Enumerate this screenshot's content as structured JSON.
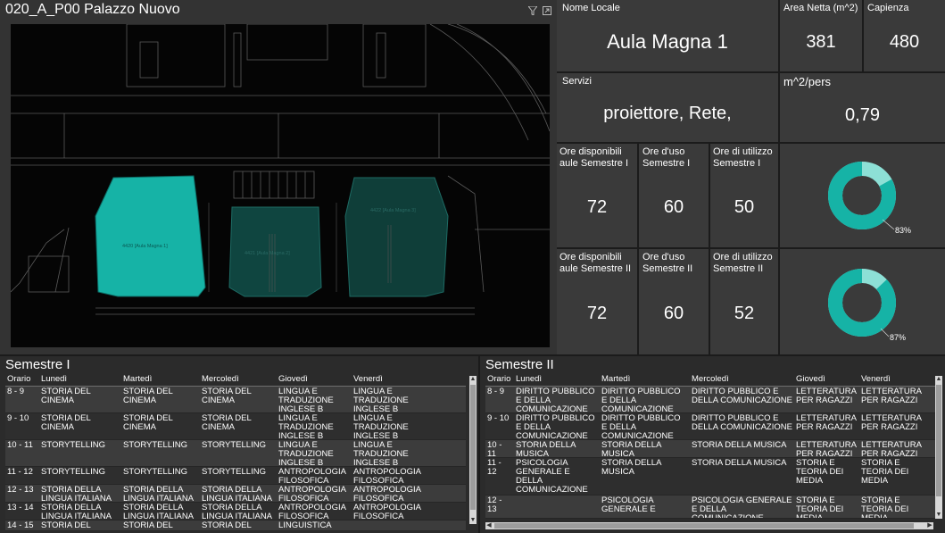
{
  "map": {
    "title": "020_A_P00 Palazzo Nuovo",
    "rooms": [
      "4420 [Aula Magna 1]",
      "4421 [Aula Magna 2]",
      "4422 [Aula Magna 3]"
    ]
  },
  "nome_locale": {
    "label": "Nome Locale",
    "value": "Aula Magna 1"
  },
  "area_netta": {
    "label": "Area Netta (m^2)",
    "value": "381"
  },
  "capienza": {
    "label": "Capienza",
    "value": "480"
  },
  "servizi": {
    "label": "Servizi",
    "value": "proiettore, Rete,"
  },
  "m2_pers": {
    "label": "m^2/pers",
    "value": "0,79"
  },
  "sem1_cards": [
    {
      "label": "Ore disponibili aule Semestre I",
      "value": "72"
    },
    {
      "label": "Ore d'uso Semestre I",
      "value": "60"
    },
    {
      "label": "Ore di utilizzo Semestre I",
      "value": "50"
    }
  ],
  "sem2_cards": [
    {
      "label": "Ore disponibili aule Semestre II",
      "value": "72"
    },
    {
      "label": "Ore d'uso Semestre II",
      "value": "60"
    },
    {
      "label": "Ore di utilizzo Semestre II",
      "value": "52"
    }
  ],
  "donut1": {
    "percent": 83,
    "label": "83%"
  },
  "donut2": {
    "percent": 87,
    "label": "87%"
  },
  "colors": {
    "teal": "#16b3a6",
    "teal_light": "#8de0d6",
    "panel": "#3a3a3a"
  },
  "semestre1": {
    "title": "Semestre I",
    "headers": [
      "Orario",
      "Lunedì",
      "Martedì",
      "Mercoledì",
      "Giovedì",
      "Venerdì"
    ],
    "rows": [
      [
        "8 - 9",
        "STORIA DEL CINEMA",
        "STORIA DEL CINEMA",
        "STORIA DEL CINEMA",
        "LINGUA E TRADUZIONE INGLESE B",
        "LINGUA E TRADUZIONE INGLESE B"
      ],
      [
        "9 - 10",
        "STORIA DEL CINEMA",
        "STORIA DEL CINEMA",
        "STORIA DEL CINEMA",
        "LINGUA E TRADUZIONE INGLESE B",
        "LINGUA E TRADUZIONE INGLESE B"
      ],
      [
        "10 - 11",
        "STORYTELLING",
        "STORYTELLING",
        "STORYTELLING",
        "LINGUA E TRADUZIONE INGLESE B",
        "LINGUA E TRADUZIONE INGLESE B"
      ],
      [
        "11 - 12",
        "STORYTELLING",
        "STORYTELLING",
        "STORYTELLING",
        "ANTROPOLOGIA FILOSOFICA",
        "ANTROPOLOGIA FILOSOFICA"
      ],
      [
        "12 - 13",
        "STORIA DELLA LINGUA ITALIANA",
        "STORIA DELLA LINGUA ITALIANA",
        "STORIA DELLA LINGUA ITALIANA",
        "ANTROPOLOGIA FILOSOFICA",
        "ANTROPOLOGIA FILOSOFICA"
      ],
      [
        "13 - 14",
        "STORIA DELLA LINGUA ITALIANA",
        "STORIA DELLA LINGUA ITALIANA",
        "STORIA DELLA LINGUA ITALIANA",
        "ANTROPOLOGIA FILOSOFICA",
        "ANTROPOLOGIA FILOSOFICA"
      ],
      [
        "14 - 15",
        "STORIA DEL",
        "STORIA DEL",
        "STORIA DEL",
        "LINGUISTICA",
        ""
      ]
    ]
  },
  "semestre2": {
    "title": "Semestre II",
    "headers": [
      "Orario",
      "Lunedì",
      "Martedì",
      "Mercoledì",
      "Giovedì",
      "Venerdì"
    ],
    "rows": [
      [
        "8 - 9",
        "DIRITTO PUBBLICO E DELLA COMUNICAZIONE",
        "DIRITTO PUBBLICO E DELLA COMUNICAZIONE",
        "DIRITTO PUBBLICO E DELLA COMUNICAZIONE",
        "LETTERATURA PER RAGAZZI",
        "LETTERATURA PER RAGAZZI"
      ],
      [
        "9 - 10",
        "DIRITTO PUBBLICO E DELLA COMUNICAZIONE",
        "DIRITTO PUBBLICO E DELLA COMUNICAZIONE",
        "DIRITTO PUBBLICO E DELLA COMUNICAZIONE",
        "LETTERATURA PER RAGAZZI",
        "LETTERATURA PER RAGAZZI"
      ],
      [
        "10 - 11",
        "STORIA DELLA MUSICA",
        "STORIA DELLA MUSICA",
        "STORIA DELLA MUSICA",
        "LETTERATURA PER RAGAZZI",
        "LETTERATURA PER RAGAZZI"
      ],
      [
        "11 - 12",
        "PSICOLOGIA GENERALE E DELLA COMUNICAZIONE",
        "STORIA DELLA MUSICA",
        "STORIA DELLA MUSICA",
        "STORIA E TEORIA DEI MEDIA",
        "STORIA E TEORIA DEI MEDIA"
      ],
      [
        "12 - 13",
        "",
        "PSICOLOGIA GENERALE E",
        "PSICOLOGIA GENERALE E DELLA COMUNICAZIONE",
        "STORIA E TEORIA DEI MEDIA",
        "STORIA E TEORIA DEI MEDIA"
      ]
    ]
  }
}
